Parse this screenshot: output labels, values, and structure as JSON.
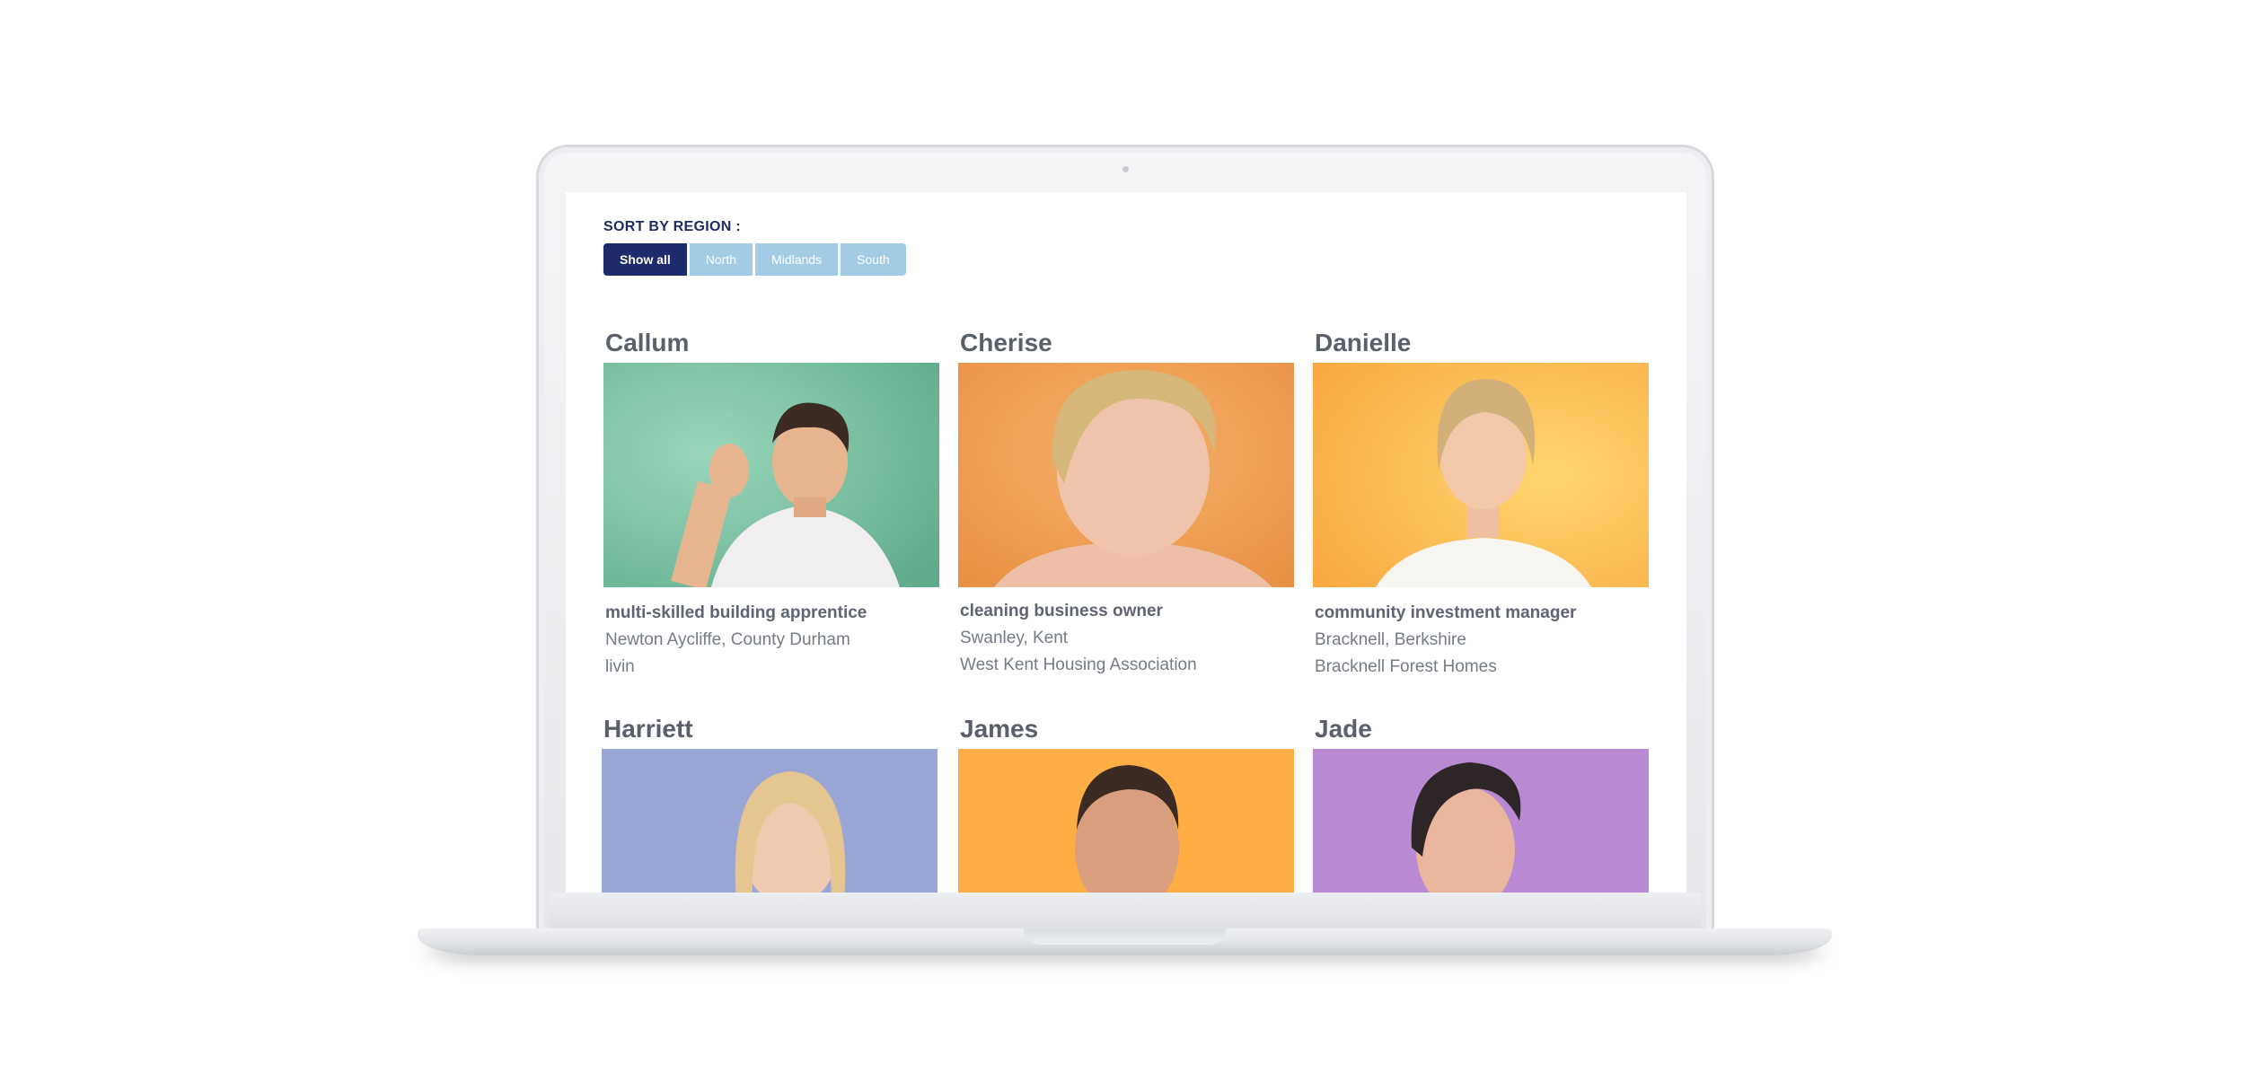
{
  "sort": {
    "label": "SORT BY REGION :",
    "filters": [
      "Show all",
      "North",
      "Midlands",
      "South"
    ],
    "selected": "Show all"
  },
  "people": [
    {
      "name": "Callum",
      "role": "multi-skilled building apprentice",
      "location": "Newton Aycliffe, County Durham",
      "organisation": "livin",
      "bg": "#7cc4a8"
    },
    {
      "name": "Cherise",
      "role": "cleaning business owner",
      "location": "Swanley, Kent",
      "organisation": "West Kent Housing Association",
      "bg": "#f29a4a"
    },
    {
      "name": "Danielle",
      "role": "community investment manager",
      "location": "Bracknell, Berkshire",
      "organisation": "Bracknell Forest Homes",
      "bg": "#ffb950"
    },
    {
      "name": "Harriett",
      "bg": "#9aa6d6"
    },
    {
      "name": "James",
      "bg": "#ffad45"
    },
    {
      "name": "Jade",
      "bg": "#b98ad3"
    }
  ],
  "colors": {
    "accent": "#1e2a6b",
    "filter": "#a2cce6",
    "name_text": "#59606a"
  }
}
